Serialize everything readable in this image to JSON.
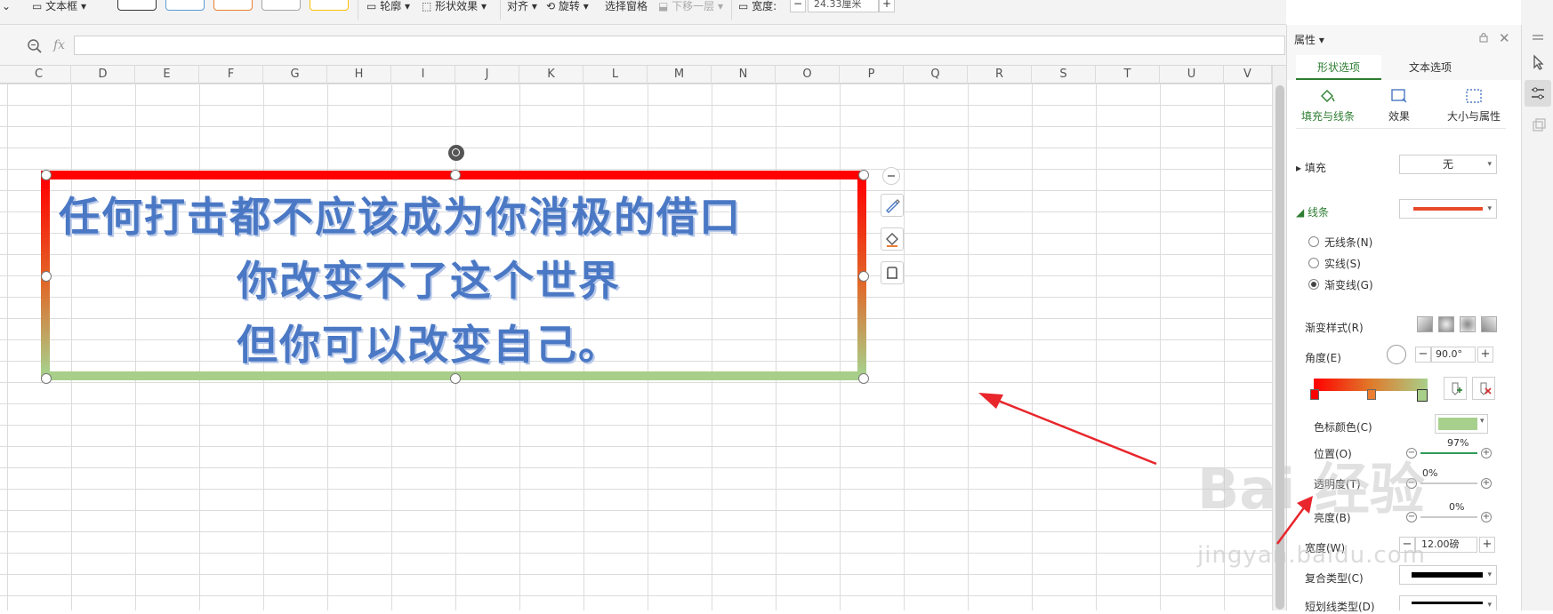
{
  "toolbar": {
    "textbox_label": "文本框",
    "outline_label": "轮廓",
    "shape_effect_label": "形状效果",
    "align_label": "对齐",
    "rotate_label": "旋转",
    "selection_pane_label": "选择窗格",
    "move_down_label": "下移一层",
    "width_label": "宽度",
    "width_value": "24.33厘米",
    "swatch_colors": [
      "#333333",
      "#5b9bd5",
      "#ed7d31",
      "#a5a5a5",
      "#ffc000"
    ]
  },
  "formula_bar": {
    "fx_label": "fx",
    "value": ""
  },
  "columns": [
    "C",
    "D",
    "E",
    "F",
    "G",
    "H",
    "I",
    "J",
    "K",
    "L",
    "M",
    "N",
    "O",
    "P",
    "Q",
    "R",
    "S",
    "T",
    "U",
    "V"
  ],
  "shape": {
    "lines": [
      "任何打击都不应该成为你消极的借口",
      "你改变不了这个世界",
      "但你可以改变自己。"
    ],
    "border_gradient": [
      "#ff0000",
      "#e06a2a",
      "#a8cf8a"
    ]
  },
  "panel": {
    "title": "属性",
    "tabs": [
      "形状选项",
      "文本选项"
    ],
    "sub_tabs": [
      "填充与线条",
      "效果",
      "大小与属性"
    ],
    "fill_label": "填充",
    "fill_value": "无",
    "line_label": "线条",
    "line_options": [
      "无线条(N)",
      "实线(S)",
      "渐变线(G)"
    ],
    "selected_line_option": "渐变线(G)",
    "gradient_style_label": "渐变样式(R)",
    "angle_label": "角度(E)",
    "angle_value": "90.0°",
    "stop_color_label": "色标颜色(C)",
    "stop_color": "#a8d08d",
    "position_label": "位置(O)",
    "position_value": "97%",
    "transparency_label": "透明度(T)",
    "transparency_value": "0%",
    "brightness_label": "亮度(B)",
    "brightness_value": "0%",
    "width_label": "宽度(W)",
    "width_value": "12.00磅",
    "compound_label": "复合类型(C)",
    "dash_label": "短划线类型(D)"
  },
  "watermark": {
    "brand": "Bai 经验",
    "url": "jingyan.baidu.com"
  }
}
